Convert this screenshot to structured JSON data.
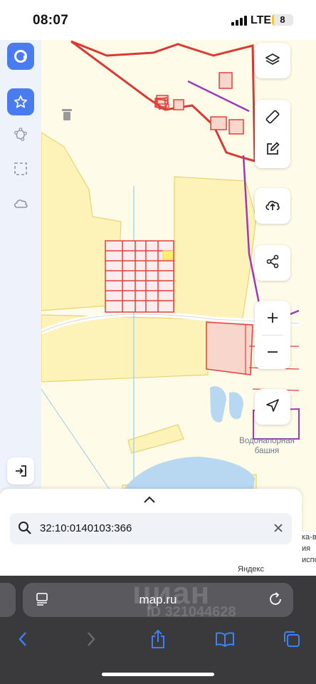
{
  "status_bar": {
    "time": "08:07",
    "network": "LTE",
    "battery": "8",
    "battery_level_percent": 8
  },
  "sidebar": {
    "items": [
      {
        "name": "logo",
        "icon": "app-logo-icon"
      },
      {
        "name": "favorites",
        "icon": "star-icon",
        "active": true
      },
      {
        "name": "draw-polygon",
        "icon": "polygon-icon"
      },
      {
        "name": "select-area",
        "icon": "dashed-square-icon"
      },
      {
        "name": "cloud",
        "icon": "cloud-icon"
      }
    ],
    "exit_icon": "login-icon"
  },
  "map_controls": [
    "layers-icon",
    "ruler-icon",
    "edit-icon",
    "upload-icon",
    "share-icon",
    "zoom-in-icon",
    "zoom-out-icon",
    "navigate-icon"
  ],
  "map": {
    "label_line1": "Водонапорная",
    "label_line2": "башня",
    "attribution": "Яндекс",
    "colors": {
      "land_fill": "#fffbe9",
      "parcel_yellow": "#fdf3b8",
      "parcel_red_border": "#e1403a",
      "parcel_pink": "#f9d6cb",
      "water": "#b8d8f2",
      "road": "#ffffff",
      "boundary_purple": "#9c3ab8"
    }
  },
  "search": {
    "value": "32:10:0140103:366"
  },
  "side_snippet": {
    "line1": "ка-в",
    "line2": "ия",
    "line3": "использо"
  },
  "browser": {
    "url": "map.ru",
    "watermark": "циан",
    "watermark_id": "ID 321044628",
    "toolbar": [
      "back-icon",
      "forward-icon",
      "share-icon",
      "bookmarks-icon",
      "tabs-icon"
    ]
  },
  "colors": {
    "accent": "#4a7cf0",
    "browser_bg": "#3a3a3c"
  }
}
